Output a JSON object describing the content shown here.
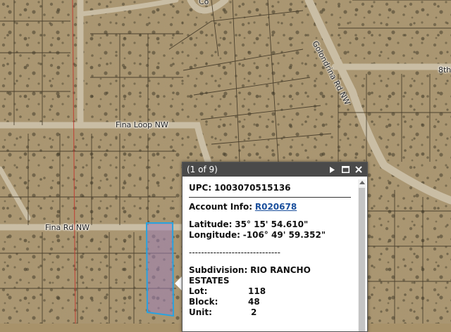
{
  "map": {
    "roads": [
      {
        "name": "Fina Loop NW"
      },
      {
        "name": "Fina Rd NW"
      },
      {
        "name": "Golondrina Rd NW"
      },
      {
        "name": "8th"
      },
      {
        "name": "Co"
      }
    ],
    "colors": {
      "terrain": "#a8926a",
      "road": "#c6b89d",
      "parcel_line": "#3a3020",
      "boundary": "#c0392b",
      "selection_fill": "#9d7fb6",
      "selection_stroke": "#29a3e0"
    }
  },
  "popup": {
    "counter": "(1 of 9)",
    "next_icon": "play-triangle",
    "maximize_icon": "square",
    "close_icon": "x",
    "upc_label": "UPC:",
    "upc_value": "1003070515136",
    "account_label": "Account Info:",
    "account_link": "R020678",
    "latitude_label": "Latitude:",
    "latitude_value": "35° 15' 54.610\"",
    "longitude_label": "Longitude:",
    "longitude_value": "-106° 49' 59.352\"",
    "separator": "------------------------------",
    "subdivision_label": "Subdivision:",
    "subdivision_value_1": "RIO RANCHO",
    "subdivision_value_2": "ESTATES",
    "lot_label": "Lot:",
    "lot_value": "118",
    "block_label": "Block:",
    "block_value": "48",
    "unit_label": "Unit:",
    "unit_value": "2"
  }
}
